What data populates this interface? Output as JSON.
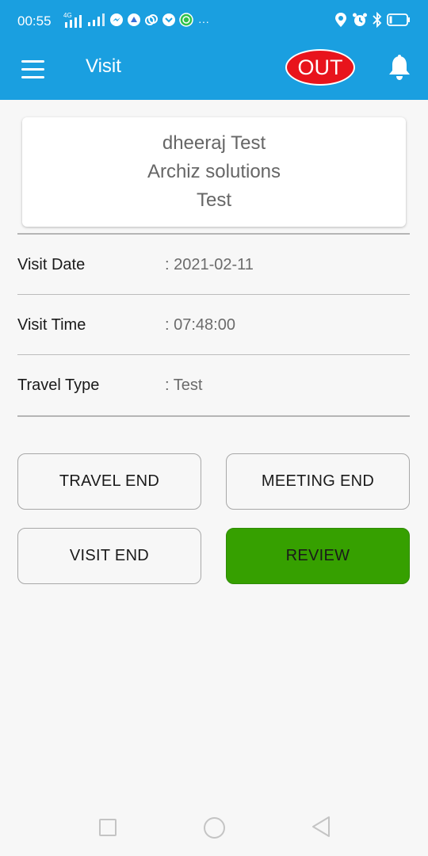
{
  "status_bar": {
    "time": "00:55",
    "network_label": "4G",
    "more_indicator": "···",
    "icons": [
      "network-4g-icon",
      "signal-icon",
      "messenger-icon",
      "app-icon",
      "cloud-icon",
      "chat-icon",
      "whatsapp-icon",
      "location-icon",
      "alarm-icon",
      "bluetooth-icon",
      "battery-icon"
    ]
  },
  "app_bar": {
    "title": "Visit",
    "out_label": "OUT",
    "accent_color": "#1a9fe0",
    "out_color": "#e8141c"
  },
  "card": {
    "name": "dheeraj Test",
    "company": "Archiz solutions",
    "extra": "Test"
  },
  "details": [
    {
      "label": "Visit Date",
      "value": ": 2021-02-11"
    },
    {
      "label": "Visit Time",
      "value": ": 07:48:00"
    },
    {
      "label": "Travel Type",
      "value": ": Test"
    }
  ],
  "buttons": {
    "travel_end": "TRAVEL END",
    "meeting_end": "MEETING END",
    "visit_end": "VISIT END",
    "review": "REVIEW",
    "review_color": "#36a000"
  },
  "nav": {
    "icons": [
      "recent-apps-icon",
      "home-icon",
      "back-icon"
    ]
  }
}
